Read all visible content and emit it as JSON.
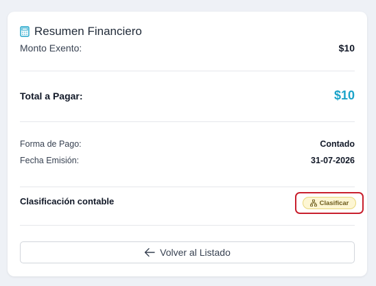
{
  "summary": {
    "title": "Resumen Financiero",
    "exempt_label": "Monto Exento:",
    "exempt_value": "$10",
    "total_label": "Total a Pagar:",
    "total_value": "$10",
    "payment_label": "Forma de Pago:",
    "payment_value": "Contado",
    "date_label": "Fecha Emisión:",
    "date_value": "31-07-2026",
    "classification_label": "Clasificación contable",
    "classify_button": "Clasificar",
    "back_button": "Volver al Listado"
  },
  "colors": {
    "accent": "#1aa3c9",
    "highlight_border": "#c81e2c",
    "badge_bg": "#fdf6d3"
  },
  "icons": {
    "header": "calculator-icon",
    "classify": "sitemap-icon",
    "back": "arrow-left-icon"
  }
}
